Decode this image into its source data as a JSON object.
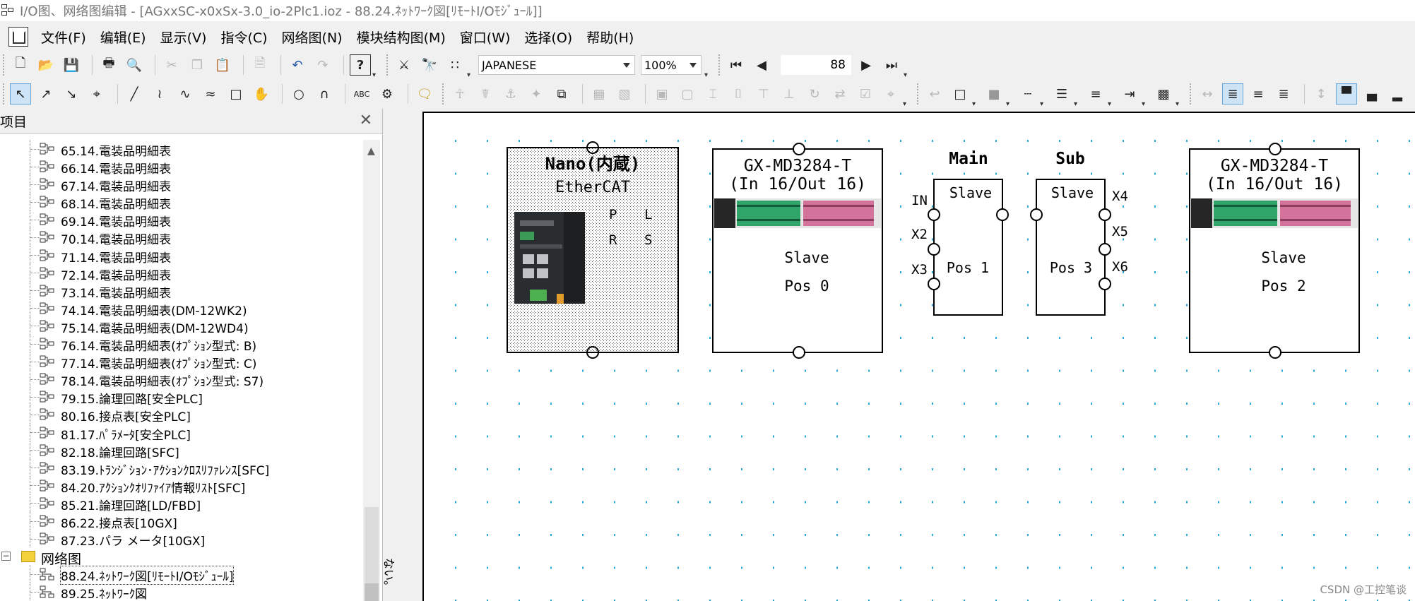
{
  "window": {
    "title": "I/O图、网络图编辑 - [AGxxSC-x0xSx-3.0_io-2Plc1.ioz - 88.24.ﾈｯﾄﾜｰｸ図[ﾘﾓｰﾄI/Oﾓｼﾞｭｰﾙ]]"
  },
  "menu": [
    {
      "label": "文件(F)"
    },
    {
      "label": "编辑(E)"
    },
    {
      "label": "显示(V)"
    },
    {
      "label": "指令(C)"
    },
    {
      "label": "网络图(N)"
    },
    {
      "label": "模块结构图(M)"
    },
    {
      "label": "窗口(W)"
    },
    {
      "label": "选择(O)"
    },
    {
      "label": "帮助(H)"
    }
  ],
  "toolbar": {
    "language": "JAPANESE",
    "zoom": "100%",
    "page_number": "88"
  },
  "panel": {
    "title": "项目",
    "items": [
      {
        "label": "65.14.電装品明細表",
        "icon": "sheet-icon"
      },
      {
        "label": "66.14.電装品明細表",
        "icon": "sheet-icon"
      },
      {
        "label": "67.14.電装品明細表",
        "icon": "sheet-icon"
      },
      {
        "label": "68.14.電装品明細表",
        "icon": "sheet-icon"
      },
      {
        "label": "69.14.電装品明細表",
        "icon": "sheet-icon"
      },
      {
        "label": "70.14.電装品明細表",
        "icon": "sheet-icon"
      },
      {
        "label": "71.14.電装品明細表",
        "icon": "sheet-icon"
      },
      {
        "label": "72.14.電装品明細表",
        "icon": "sheet-icon"
      },
      {
        "label": "73.14.電装品明細表",
        "icon": "sheet-icon"
      },
      {
        "label": "74.14.電装品明細表(DM-12WK2)",
        "icon": "sheet-icon"
      },
      {
        "label": "75.14.電装品明細表(DM-12WD4)",
        "icon": "sheet-icon"
      },
      {
        "label": "76.14.電装品明細表(ｵﾌﾟｼｮﾝ型式: B)",
        "icon": "sheet-icon"
      },
      {
        "label": "77.14.電装品明細表(ｵﾌﾟｼｮﾝ型式: C)",
        "icon": "sheet-icon"
      },
      {
        "label": "78.14.電装品明細表(ｵﾌﾟｼｮﾝ型式: S7)",
        "icon": "sheet-icon"
      },
      {
        "label": "79.15.論理回路[安全PLC]",
        "icon": "sheet-icon"
      },
      {
        "label": "80.16.接点表[安全PLC]",
        "icon": "sheet-icon"
      },
      {
        "label": "81.17.ﾊﾟﾗﾒｰﾀ[安全PLC]",
        "icon": "sheet-icon"
      },
      {
        "label": "82.18.論理回路[SFC]",
        "icon": "sheet-icon"
      },
      {
        "label": "83.19.ﾄﾗﾝｼﾞｼｮﾝ･ｱｸｼｮﾝｸﾛｽﾘﾌｧﾚﾝｽ[SFC]",
        "icon": "sheet-icon"
      },
      {
        "label": "84.20.ｱｸｼｮﾝｸｵﾘﾌｧｲｱ情報ﾘｽﾄ[SFC]",
        "icon": "sheet-icon"
      },
      {
        "label": "85.21.論理回路[LD/FBD]",
        "icon": "sheet-icon"
      },
      {
        "label": "86.22.接点表[10GX]",
        "icon": "sheet-icon"
      },
      {
        "label": "87.23.パラ メータ[10GX]",
        "icon": "sheet-icon"
      }
    ],
    "folder": {
      "label": "网络图",
      "icon": "folder-icon",
      "expander": "−"
    },
    "network_items": [
      {
        "label": "88.24.ﾈｯﾄﾜｰｸ図[ﾘﾓｰﾄI/Oﾓｼﾞｭｰﾙ]",
        "icon": "network-icon",
        "selected": true
      },
      {
        "label": "89.25.ﾈｯﾄﾜｰｸ図",
        "icon": "network-icon",
        "selected": false
      }
    ]
  },
  "diagram": {
    "controller": {
      "name": "Nano(内蔵)",
      "protocol": "EtherCAT",
      "port_labels": [
        "P",
        "L",
        "R",
        "S"
      ]
    },
    "module_left": {
      "line1": "GX-MD3284-T",
      "line2": "(In 16/Out 16)",
      "role": "Slave",
      "position": "Pos 0"
    },
    "main": {
      "title": "Main",
      "role": "Slave",
      "position": "Pos 1",
      "ports": [
        "IN",
        "X2",
        "X3"
      ]
    },
    "sub": {
      "title": "Sub",
      "role": "Slave",
      "position": "Pos 3",
      "ports": [
        "X4",
        "X5",
        "X6"
      ]
    },
    "module_right": {
      "line1": "GX-MD3284-T",
      "line2": "(In 16/Out 16)",
      "role": "Slave",
      "position": "Pos 2"
    },
    "margin_note": "ない。"
  },
  "colors": {
    "grid_dot": "#2aa6d8",
    "connector_green": "#2fa56a",
    "connector_pink": "#d3729a",
    "toggle_active": "#cde4f7"
  },
  "watermark": "CSDN @工控笔谈"
}
